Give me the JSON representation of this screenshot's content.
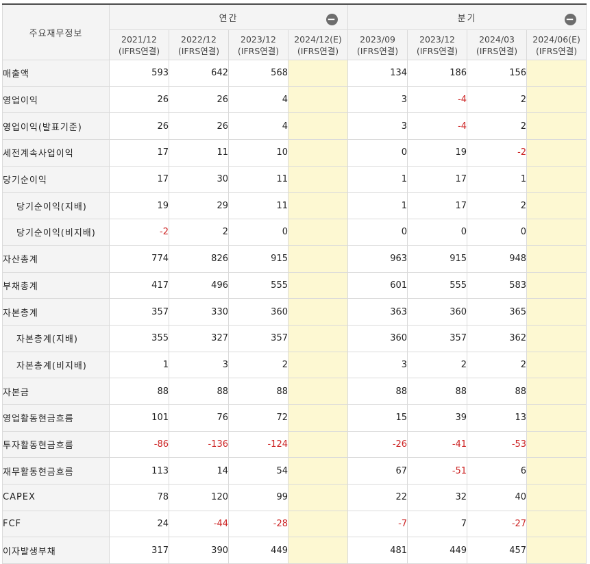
{
  "table": {
    "corner_label": "주요재무정보",
    "group_labels": {
      "annual": "연간",
      "quarterly": "분기"
    },
    "fold_icon": "−",
    "annual_periods": [
      {
        "date": "2021/12",
        "basis": "(IFRS연결)"
      },
      {
        "date": "2022/12",
        "basis": "(IFRS연결)"
      },
      {
        "date": "2023/12",
        "basis": "(IFRS연결)"
      },
      {
        "date": "2024/12(E)",
        "basis": "(IFRS연결)"
      }
    ],
    "quarter_periods": [
      {
        "date": "2023/09",
        "basis": "(IFRS연결)"
      },
      {
        "date": "2023/12",
        "basis": "(IFRS연결)"
      },
      {
        "date": "2024/03",
        "basis": "(IFRS연결)"
      },
      {
        "date": "2024/06(E)",
        "basis": "(IFRS연결)"
      }
    ],
    "estimate_highlight_color": "#fdf8d2",
    "negative_color": "#cc2222",
    "rows": [
      {
        "label": "매출액",
        "sub": false,
        "annual": [
          "593",
          "642",
          "568",
          ""
        ],
        "quarter": [
          "134",
          "186",
          "156",
          ""
        ]
      },
      {
        "label": "영업이익",
        "sub": false,
        "annual": [
          "26",
          "26",
          "4",
          ""
        ],
        "quarter": [
          "3",
          "-4",
          "2",
          ""
        ]
      },
      {
        "label": "영업이익(발표기준)",
        "sub": false,
        "annual": [
          "26",
          "26",
          "4",
          ""
        ],
        "quarter": [
          "3",
          "-4",
          "2",
          ""
        ]
      },
      {
        "label": "세전계속사업이익",
        "sub": false,
        "annual": [
          "17",
          "11",
          "10",
          ""
        ],
        "quarter": [
          "0",
          "19",
          "-2",
          ""
        ]
      },
      {
        "label": "당기순이익",
        "sub": false,
        "annual": [
          "17",
          "30",
          "11",
          ""
        ],
        "quarter": [
          "1",
          "17",
          "1",
          ""
        ]
      },
      {
        "label": "당기순이익(지배)",
        "sub": true,
        "annual": [
          "19",
          "29",
          "11",
          ""
        ],
        "quarter": [
          "1",
          "17",
          "2",
          ""
        ]
      },
      {
        "label": "당기순이익(비지배)",
        "sub": true,
        "annual": [
          "-2",
          "2",
          "0",
          ""
        ],
        "quarter": [
          "0",
          "0",
          "0",
          ""
        ]
      },
      {
        "label": "자산총계",
        "sub": false,
        "annual": [
          "774",
          "826",
          "915",
          ""
        ],
        "quarter": [
          "963",
          "915",
          "948",
          ""
        ]
      },
      {
        "label": "부채총계",
        "sub": false,
        "annual": [
          "417",
          "496",
          "555",
          ""
        ],
        "quarter": [
          "601",
          "555",
          "583",
          ""
        ]
      },
      {
        "label": "자본총계",
        "sub": false,
        "annual": [
          "357",
          "330",
          "360",
          ""
        ],
        "quarter": [
          "363",
          "360",
          "365",
          ""
        ]
      },
      {
        "label": "자본총계(지배)",
        "sub": true,
        "annual": [
          "355",
          "327",
          "357",
          ""
        ],
        "quarter": [
          "360",
          "357",
          "362",
          ""
        ]
      },
      {
        "label": "자본총계(비지배)",
        "sub": true,
        "annual": [
          "1",
          "3",
          "2",
          ""
        ],
        "quarter": [
          "3",
          "2",
          "2",
          ""
        ]
      },
      {
        "label": "자본금",
        "sub": false,
        "annual": [
          "88",
          "88",
          "88",
          ""
        ],
        "quarter": [
          "88",
          "88",
          "88",
          ""
        ]
      },
      {
        "label": "영업활동현금흐름",
        "sub": false,
        "annual": [
          "101",
          "76",
          "72",
          ""
        ],
        "quarter": [
          "15",
          "39",
          "13",
          ""
        ]
      },
      {
        "label": "투자활동현금흐름",
        "sub": false,
        "annual": [
          "-86",
          "-136",
          "-124",
          ""
        ],
        "quarter": [
          "-26",
          "-41",
          "-53",
          ""
        ]
      },
      {
        "label": "재무활동현금흐름",
        "sub": false,
        "annual": [
          "113",
          "14",
          "54",
          ""
        ],
        "quarter": [
          "67",
          "-51",
          "6",
          ""
        ]
      },
      {
        "label": "CAPEX",
        "sub": false,
        "annual": [
          "78",
          "120",
          "99",
          ""
        ],
        "quarter": [
          "22",
          "32",
          "40",
          ""
        ]
      },
      {
        "label": "FCF",
        "sub": false,
        "annual": [
          "24",
          "-44",
          "-28",
          ""
        ],
        "quarter": [
          "-7",
          "7",
          "-27",
          ""
        ]
      },
      {
        "label": "이자발생부채",
        "sub": false,
        "annual": [
          "317",
          "390",
          "449",
          ""
        ],
        "quarter": [
          "481",
          "449",
          "457",
          ""
        ]
      }
    ]
  }
}
